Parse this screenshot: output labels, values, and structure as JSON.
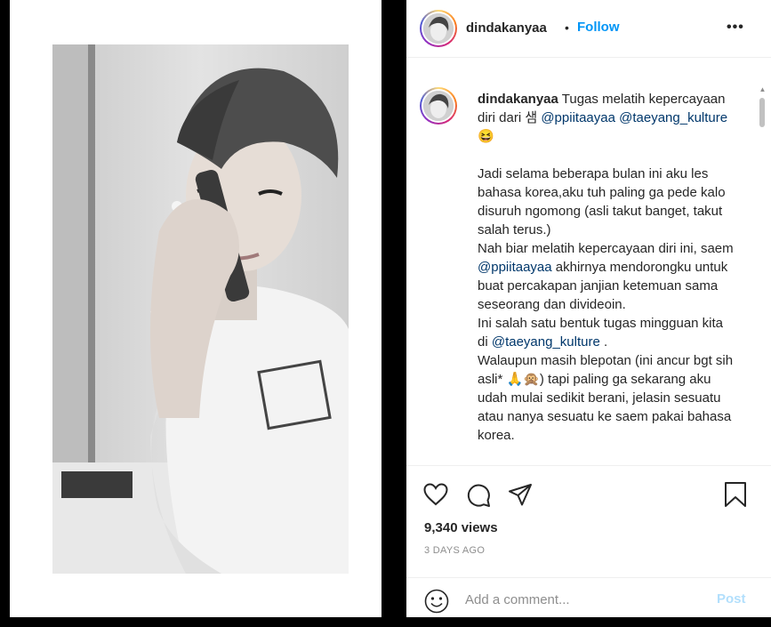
{
  "post": {
    "username": "dindakanyaa",
    "separator": "•",
    "follow_label": "Follow",
    "more_label": "•••"
  },
  "caption": {
    "username": "dindakanyaa",
    "seg1": " Tugas melatih kepercayaan diri dari 샘 ",
    "mention1": "@ppiitaayaa",
    "seg2": " ",
    "mention2": "@taeyang_kulture",
    "seg3": " 😆\n\nJadi selama beberapa bulan ini aku les bahasa korea,aku tuh paling ga pede kalo disuruh ngomong (asli takut banget, takut salah terus.)\nNah biar melatih kepercayaan diri ini, saem ",
    "mention3": "@ppiitaayaa",
    "seg4": " akhirnya mendorongku untuk buat percakapan janjian ketemuan sama seseorang dan divideoin.\nIni salah satu bentuk tugas mingguan kita di ",
    "mention4": "@taeyang_kulture",
    "seg5": " .\nWalaupun masih blepotan (ini ancur bgt sih asli* 🙏🙊) tapi paling ga sekarang aku udah mulai sedikit berani, jelasin sesuatu atau nanya sesuatu ke saem pakai bahasa korea."
  },
  "stats": {
    "views": "9,340 views",
    "time": "3 DAYS AGO"
  },
  "comment_box": {
    "placeholder": "Add a comment...",
    "post_label": "Post"
  },
  "icons": {
    "like": "heart-icon",
    "comment": "comment-bubble-icon",
    "share": "paper-plane-icon",
    "save": "bookmark-icon",
    "emoji": "smiley-icon",
    "more": "ellipsis-icon"
  },
  "colors": {
    "follow": "#0095f6",
    "mention": "#00376b",
    "post_disabled": "#b2dffc",
    "muted": "#8e8e8e"
  }
}
